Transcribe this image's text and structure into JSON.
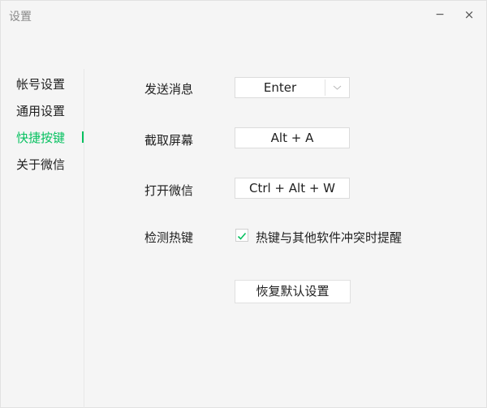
{
  "window": {
    "title": "设置",
    "minimize_symbol": "−",
    "close_symbol": "×"
  },
  "sidebar": {
    "items": [
      {
        "label": "帐号设置",
        "active": false
      },
      {
        "label": "通用设置",
        "active": false
      },
      {
        "label": "快捷按键",
        "active": true
      },
      {
        "label": "关于微信",
        "active": false
      }
    ]
  },
  "shortcuts": {
    "send_message": {
      "label": "发送消息",
      "value": "Enter",
      "icon": "chevron-down-icon"
    },
    "screenshot": {
      "label": "截取屏幕",
      "value": "Alt + A"
    },
    "open_wechat": {
      "label": "打开微信",
      "value": "Ctrl + Alt + W"
    },
    "detect_hotkeys": {
      "label": "检测热键",
      "checkbox_label": "热键与其他软件冲突时提醒",
      "checked": true
    },
    "restore_default_label": "恢复默认设置"
  },
  "colors": {
    "accent": "#07c160",
    "background": "#f5f5f5",
    "text": "#1f1f1f",
    "muted": "#8a8a8a"
  }
}
